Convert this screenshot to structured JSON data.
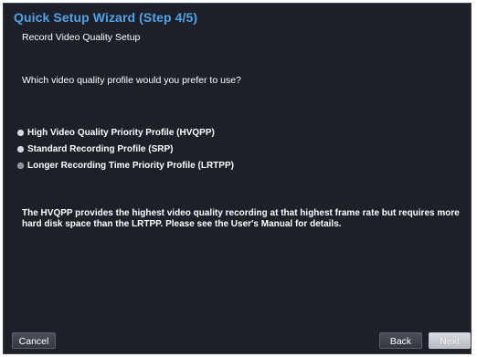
{
  "window": {
    "title": "Quick Setup Wizard (Step 4/5)",
    "subtitle": "Record Video Quality Setup"
  },
  "question": "Which video quality profile would you prefer to use?",
  "options": [
    {
      "label": "High Video Quality Priority Profile (HVQPP)",
      "selected": true
    },
    {
      "label": "Standard Recording Profile (SRP)",
      "selected": true
    },
    {
      "label": "Longer Recording Time Priority Profile (LRTPP)",
      "selected": false
    }
  ],
  "description": "The HVQPP provides the highest video quality recording at that highest frame rate but requires more hard disk space than the LRTPP. Please see the User's Manual for details.",
  "buttons": {
    "cancel": "Cancel",
    "back": "Back",
    "next": "Next"
  }
}
